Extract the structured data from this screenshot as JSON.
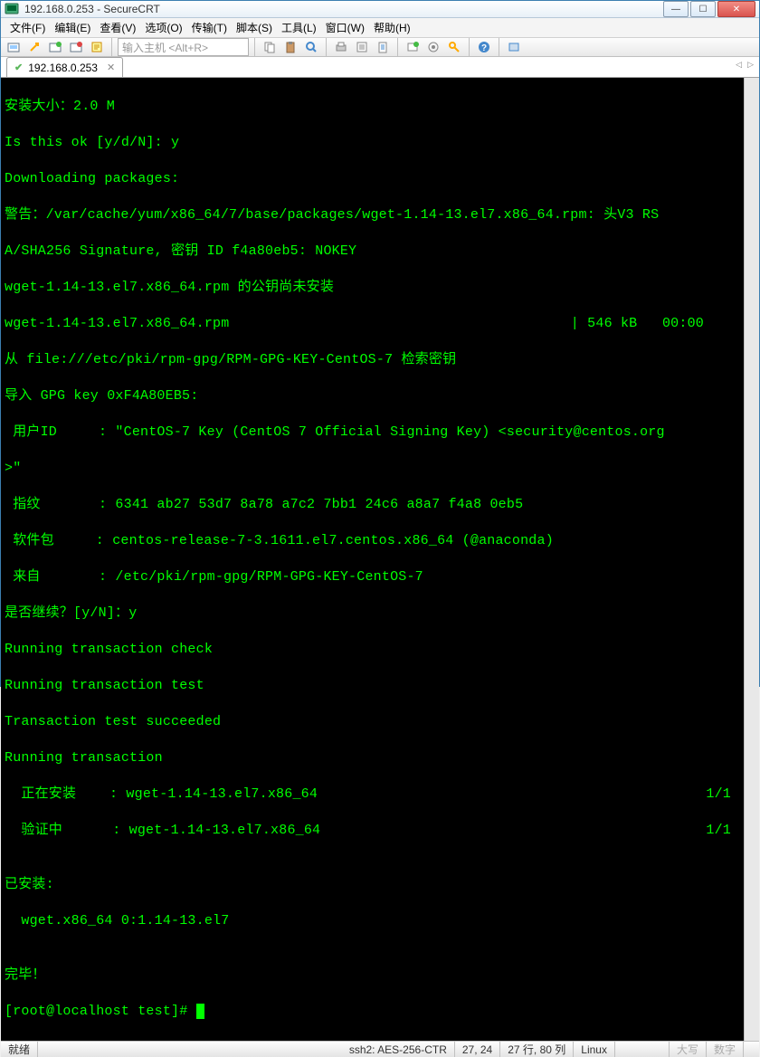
{
  "window": {
    "title": "192.168.0.253 - SecureCRT"
  },
  "menu": {
    "file": "文件(F)",
    "edit": "编辑(E)",
    "view": "查看(V)",
    "options": "选项(O)",
    "transfer": "传输(T)",
    "script": "脚本(S)",
    "tools": "工具(L)",
    "window": "窗口(W)",
    "help": "帮助(H)"
  },
  "toolbar": {
    "host_placeholder": "输入主机 <Alt+R>"
  },
  "tab": {
    "label": "192.168.0.253"
  },
  "term": {
    "l1": "安装大小：2.0 M",
    "l2": "Is this ok [y/d/N]: y",
    "l3": "Downloading packages:",
    "l4": "警告：/var/cache/yum/x86_64/7/base/packages/wget-1.14-13.el7.x86_64.rpm: 头V3 RS",
    "l5": "A/SHA256 Signature, 密钥 ID f4a80eb5: NOKEY",
    "l6": "wget-1.14-13.el7.x86_64.rpm 的公钥尚未安装",
    "l7a": "wget-1.14-13.el7.x86_64.rpm",
    "l7b": "| 546 kB   00:00",
    "l8": "从 file:///etc/pki/rpm-gpg/RPM-GPG-KEY-CentOS-7 检索密钥",
    "l9": "导入 GPG key 0xF4A80EB5:",
    "l10": " 用户ID     : \"CentOS-7 Key (CentOS 7 Official Signing Key) <security@centos.org",
    "l11": ">\"",
    "l12": " 指纹       : 6341 ab27 53d7 8a78 a7c2 7bb1 24c6 a8a7 f4a8 0eb5",
    "l13": " 软件包     : centos-release-7-3.1611.el7.centos.x86_64 (@anaconda)",
    "l14": " 来自       : /etc/pki/rpm-gpg/RPM-GPG-KEY-CentOS-7",
    "l15": "是否继续？[y/N]：y",
    "l16": "Running transaction check",
    "l17": "Running transaction test",
    "l18": "Transaction test succeeded",
    "l19": "Running transaction",
    "l20a": "  正在安装    : wget-1.14-13.el7.x86_64",
    "l20b": "1/1",
    "l21a": "  验证中      : wget-1.14-13.el7.x86_64",
    "l21b": "1/1",
    "l22": "",
    "l23": "已安装:",
    "l24": "  wget.x86_64 0:1.14-13.el7",
    "l25": "",
    "l26": "完毕！",
    "l27": "[root@localhost test]# "
  },
  "status": {
    "ready": "就绪",
    "proto": "ssh2: AES-256-CTR",
    "pos": "27, 24",
    "size": "27 行, 80 列",
    "mode": "Linux",
    "caps": "大写",
    "num": "数字"
  }
}
